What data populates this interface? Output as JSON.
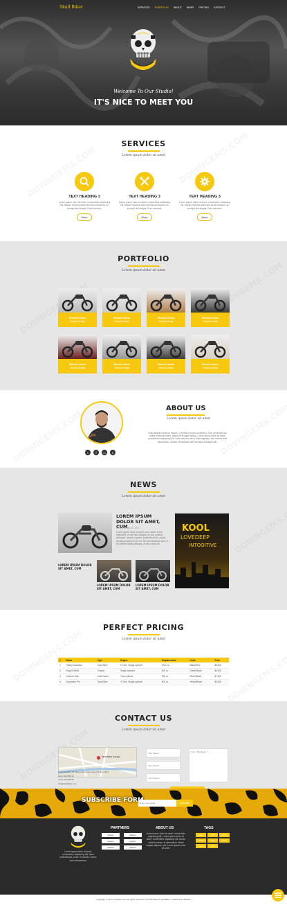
{
  "nav": {
    "logo": "Skull Biker",
    "items": [
      "SERVICES",
      "PORTFOLIO",
      "ABOUT",
      "NEWS",
      "PRICING",
      "CONTACT"
    ]
  },
  "hero": {
    "subtitle": "Welcome To Our Studio!",
    "title": "IT'S NICE TO MEET YOU"
  },
  "services": {
    "title": "SERVICES",
    "tagline": "Lorem ipsum dolor sit amet",
    "items": [
      {
        "icon": "search-icon",
        "heading": "TEXT HEADING 3",
        "text": "Lorem ipsum dolor sit amet, consectetur adipiscing elit. Mauris rhoncus diam sed lacus tincidunt, ac suscipit nisi feugiat. Duis euismod.",
        "button": "More"
      },
      {
        "icon": "tools-icon",
        "heading": "TEXT HEADING 3",
        "text": "Lorem ipsum dolor sit amet, consectetur adipiscing elit. Mauris rhoncus diam sed lacus tincidunt, ac suscipit nisi feugiat. Duis euismod.",
        "button": "More"
      },
      {
        "icon": "gear-icon",
        "heading": "TEXT HEADING 3",
        "text": "Lorem ipsum dolor sit amet, consectetur adipiscing elit. Mauris rhoncus diam sed lacus tincidunt, ac suscipit nisi feugiat. Duis euismod.",
        "button": "More"
      }
    ]
  },
  "portfolio": {
    "title": "PORTFOLIO",
    "tagline": "Lorem ipsum dolor sit amet",
    "items": [
      {
        "title": "Round Icons",
        "sub": "Graphic Design"
      },
      {
        "title": "Round Icons",
        "sub": "Graphic Design"
      },
      {
        "title": "Round Icons",
        "sub": "Graphic Design"
      },
      {
        "title": "Round Icons",
        "sub": "Graphic Design"
      },
      {
        "title": "Round Icons",
        "sub": "Graphic Design"
      },
      {
        "title": "Round Icons",
        "sub": "Graphic Design"
      },
      {
        "title": "Round Icons",
        "sub": "Graphic Design"
      },
      {
        "title": "Round Icons",
        "sub": "Graphic Design"
      }
    ]
  },
  "about": {
    "title": "ABOUT US",
    "tagline": "Lorem ipsum dolor sit amet",
    "text": "Nulla aliquet euismod mauris, ut faucibus nunc convallis a. Duis venenatis dui mollis tincidunt luctus. Morbi vel feugiat massa. Lorem ipsum dolor sit amet, consectetur adipiscing elit. Nulla ultricies nisl id diam egestas, sed viverra ante elementum. Nullam vel facilisis velit, tincidunt volutpat velit.",
    "social": [
      "twitter-icon",
      "facebook-icon",
      "linkedin-icon",
      "skype-icon"
    ]
  },
  "news": {
    "title": "NEWS",
    "tagline": "Lorem ipsum dolor sit amet",
    "main": {
      "title": "LOREM IPSUM DOLOR SIT AMET, CUM",
      "meta": "By Admin  Jan 15, 2017",
      "text": "Lorem ipsum dolor sit amet, cum natum simul offendit id, et duo illud oblique, ex eos nostrud principes. Aeque corpora voluptaria vel ei, augue ornatus ponderum pro ne. Ne ferri deserunt eam. In his viderer facilisi delicata, at hinc nobis vel.",
      "side_title": "LOREM IPSUM DOLOR SIT AMET, CUM"
    },
    "small": [
      {
        "title": "LOREM IPSUM DOLOR SIT AMET, CUM"
      },
      {
        "title": "LOREM IPSUM DOLOR SIT AMET, CUM"
      }
    ],
    "poster": {
      "line1": "KOOL",
      "line2": "LOVEDEEP",
      "line3": "INTOOITIVE"
    }
  },
  "pricing": {
    "title": "PERFECT PRICING",
    "tagline": "Lorem ipsum dolor sit amet",
    "headers": [
      "#",
      "Name",
      "Type",
      "Engine",
      "Displacement",
      "Color",
      "Price"
    ],
    "rows": [
      [
        "1",
        "Harley-Davidson",
        "Sport Bike",
        "V-Twin, Single-cylinder",
        "1200 cc",
        "Black/Red",
        "$8,000"
      ],
      [
        "2",
        "Royal Enfield",
        "Classic",
        "Single-cylinder",
        "500 cc",
        "Green/Black",
        "$5,000"
      ],
      [
        "3",
        "Custom Cafe",
        "Cafe Racer",
        "Twin-cylinder",
        "750 cc",
        "Silver/Black",
        "$7,500"
      ],
      [
        "4",
        "Scrambler Pro",
        "Sport Bike",
        "V-Twin, Single-cylinder",
        "900 cc",
        "Yellow/Black",
        "$9,000"
      ]
    ]
  },
  "contact": {
    "title": "CONTACT US",
    "tagline": "Lorem ipsum dolor sit amet",
    "address": "A: Amsterdam 20 Street Oxford 22 Long, PO Box 1234",
    "phone1": "+121 333 888 12",
    "phone2": "+121 444 999 55",
    "email": "info@skullbiker.com",
    "placeholders": {
      "name": "Your Name *",
      "email": "Your Email *",
      "phone": "Your Phone *",
      "message": "Your Message *"
    },
    "button": "SEND MESSAGE",
    "map_label": "Skull Biker Garage"
  },
  "subscribe": {
    "title": "SUBSCRIBE FORM",
    "placeholder": "Enter your email",
    "button": "Subscribe"
  },
  "footer": {
    "intro": "Lorem ipsum dolor sit amet, consectetur adipiscing elit. Nam pellentesque, lorem in lobortis. Donec dolor elementum.",
    "partners_title": "PARTNERS",
    "partners": [
      "partner",
      "partner",
      "partner",
      "partner",
      "partner",
      "partner"
    ],
    "about_title": "ABOUT US",
    "about_text": "Lorem ipsum dolor sit amet, consectetur adipiscing elit. Lorem ipsum dolor sit amet, consectetur adipiscing elit. Donec lobortis massa, in elementum. Morbi magna aliquam, sed. Lorem ipsum dolor sit amet.",
    "tags_title": "TAGS",
    "tags": [
      "bikes",
      "skull",
      "custom",
      "garage",
      "racer",
      "biker",
      "motor",
      "cafe"
    ],
    "copyright": "Copyright © SKC Company.com. All rights reserved. Free Template by SkullBike - Collect from Website"
  },
  "colors": {
    "accent": "#f6c90e",
    "dark": "#2a2a2a",
    "gray": "#e6e6e6"
  }
}
